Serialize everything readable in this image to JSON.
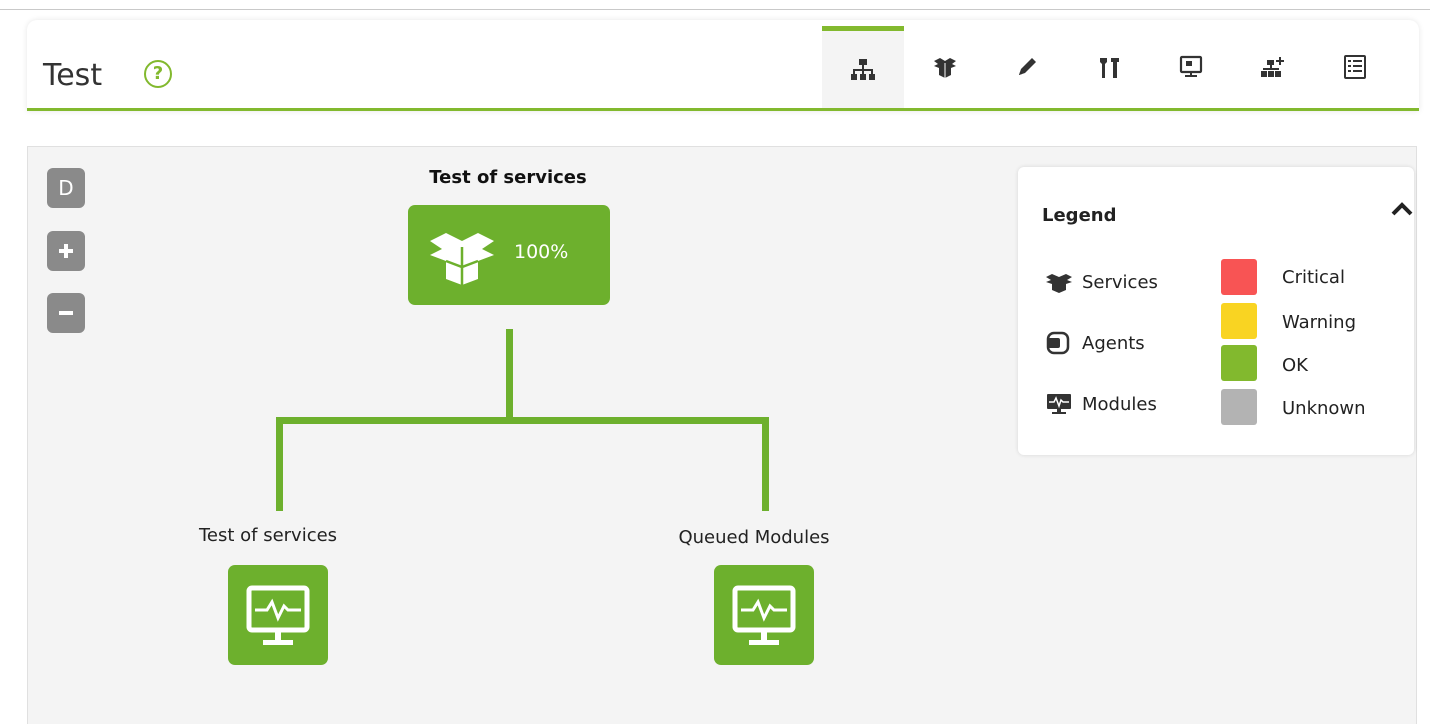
{
  "header": {
    "title": "Test",
    "help_icon": "?",
    "tabs": [
      {
        "name": "tab-service-map",
        "icon": "hierarchy-icon",
        "active": true
      },
      {
        "name": "tab-services",
        "icon": "boxes-icon",
        "active": false
      },
      {
        "name": "tab-edit",
        "icon": "pencil-icon",
        "active": false
      },
      {
        "name": "tab-tools",
        "icon": "tools-icon",
        "active": false
      },
      {
        "name": "tab-monitor",
        "icon": "monitor-icon",
        "active": false
      },
      {
        "name": "tab-add-node",
        "icon": "add-node-icon",
        "active": false
      },
      {
        "name": "tab-list",
        "icon": "list-icon",
        "active": false
      }
    ]
  },
  "map": {
    "controls": {
      "default_label": "D",
      "zoom_in": "+",
      "zoom_out": "−"
    },
    "root": {
      "title": "Test of services",
      "percent": "100%",
      "status": "OK"
    },
    "children": [
      {
        "label": "Test of services",
        "type": "module",
        "status": "OK"
      },
      {
        "label": "Queued Modules",
        "type": "module",
        "status": "OK"
      }
    ]
  },
  "legend": {
    "title": "Legend",
    "types": [
      {
        "label": "Services",
        "icon": "services-icon"
      },
      {
        "label": "Agents",
        "icon": "agents-icon"
      },
      {
        "label": "Modules",
        "icon": "modules-icon"
      }
    ],
    "statuses": [
      {
        "label": "Critical",
        "color": "#f85454"
      },
      {
        "label": "Warning",
        "color": "#f9d422"
      },
      {
        "label": "OK",
        "color": "#82b92e"
      },
      {
        "label": "Unknown",
        "color": "#b3b3b3"
      }
    ]
  },
  "colors": {
    "accent": "#82b92e",
    "node": "#6db02d"
  }
}
